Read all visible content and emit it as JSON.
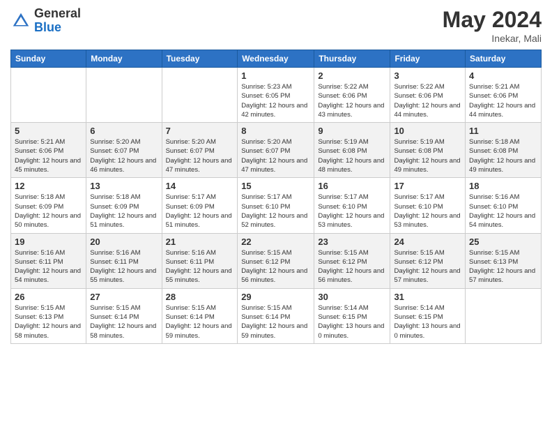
{
  "logo": {
    "general": "General",
    "blue": "Blue"
  },
  "title": "May 2024",
  "location": "Inekar, Mali",
  "headers": [
    "Sunday",
    "Monday",
    "Tuesday",
    "Wednesday",
    "Thursday",
    "Friday",
    "Saturday"
  ],
  "weeks": [
    [
      {
        "day": "",
        "sunrise": "",
        "sunset": "",
        "daylight": ""
      },
      {
        "day": "",
        "sunrise": "",
        "sunset": "",
        "daylight": ""
      },
      {
        "day": "",
        "sunrise": "",
        "sunset": "",
        "daylight": ""
      },
      {
        "day": "1",
        "sunrise": "Sunrise: 5:23 AM",
        "sunset": "Sunset: 6:05 PM",
        "daylight": "Daylight: 12 hours and 42 minutes."
      },
      {
        "day": "2",
        "sunrise": "Sunrise: 5:22 AM",
        "sunset": "Sunset: 6:06 PM",
        "daylight": "Daylight: 12 hours and 43 minutes."
      },
      {
        "day": "3",
        "sunrise": "Sunrise: 5:22 AM",
        "sunset": "Sunset: 6:06 PM",
        "daylight": "Daylight: 12 hours and 44 minutes."
      },
      {
        "day": "4",
        "sunrise": "Sunrise: 5:21 AM",
        "sunset": "Sunset: 6:06 PM",
        "daylight": "Daylight: 12 hours and 44 minutes."
      }
    ],
    [
      {
        "day": "5",
        "sunrise": "Sunrise: 5:21 AM",
        "sunset": "Sunset: 6:06 PM",
        "daylight": "Daylight: 12 hours and 45 minutes."
      },
      {
        "day": "6",
        "sunrise": "Sunrise: 5:20 AM",
        "sunset": "Sunset: 6:07 PM",
        "daylight": "Daylight: 12 hours and 46 minutes."
      },
      {
        "day": "7",
        "sunrise": "Sunrise: 5:20 AM",
        "sunset": "Sunset: 6:07 PM",
        "daylight": "Daylight: 12 hours and 47 minutes."
      },
      {
        "day": "8",
        "sunrise": "Sunrise: 5:20 AM",
        "sunset": "Sunset: 6:07 PM",
        "daylight": "Daylight: 12 hours and 47 minutes."
      },
      {
        "day": "9",
        "sunrise": "Sunrise: 5:19 AM",
        "sunset": "Sunset: 6:08 PM",
        "daylight": "Daylight: 12 hours and 48 minutes."
      },
      {
        "day": "10",
        "sunrise": "Sunrise: 5:19 AM",
        "sunset": "Sunset: 6:08 PM",
        "daylight": "Daylight: 12 hours and 49 minutes."
      },
      {
        "day": "11",
        "sunrise": "Sunrise: 5:18 AM",
        "sunset": "Sunset: 6:08 PM",
        "daylight": "Daylight: 12 hours and 49 minutes."
      }
    ],
    [
      {
        "day": "12",
        "sunrise": "Sunrise: 5:18 AM",
        "sunset": "Sunset: 6:09 PM",
        "daylight": "Daylight: 12 hours and 50 minutes."
      },
      {
        "day": "13",
        "sunrise": "Sunrise: 5:18 AM",
        "sunset": "Sunset: 6:09 PM",
        "daylight": "Daylight: 12 hours and 51 minutes."
      },
      {
        "day": "14",
        "sunrise": "Sunrise: 5:17 AM",
        "sunset": "Sunset: 6:09 PM",
        "daylight": "Daylight: 12 hours and 51 minutes."
      },
      {
        "day": "15",
        "sunrise": "Sunrise: 5:17 AM",
        "sunset": "Sunset: 6:10 PM",
        "daylight": "Daylight: 12 hours and 52 minutes."
      },
      {
        "day": "16",
        "sunrise": "Sunrise: 5:17 AM",
        "sunset": "Sunset: 6:10 PM",
        "daylight": "Daylight: 12 hours and 53 minutes."
      },
      {
        "day": "17",
        "sunrise": "Sunrise: 5:17 AM",
        "sunset": "Sunset: 6:10 PM",
        "daylight": "Daylight: 12 hours and 53 minutes."
      },
      {
        "day": "18",
        "sunrise": "Sunrise: 5:16 AM",
        "sunset": "Sunset: 6:10 PM",
        "daylight": "Daylight: 12 hours and 54 minutes."
      }
    ],
    [
      {
        "day": "19",
        "sunrise": "Sunrise: 5:16 AM",
        "sunset": "Sunset: 6:11 PM",
        "daylight": "Daylight: 12 hours and 54 minutes."
      },
      {
        "day": "20",
        "sunrise": "Sunrise: 5:16 AM",
        "sunset": "Sunset: 6:11 PM",
        "daylight": "Daylight: 12 hours and 55 minutes."
      },
      {
        "day": "21",
        "sunrise": "Sunrise: 5:16 AM",
        "sunset": "Sunset: 6:11 PM",
        "daylight": "Daylight: 12 hours and 55 minutes."
      },
      {
        "day": "22",
        "sunrise": "Sunrise: 5:15 AM",
        "sunset": "Sunset: 6:12 PM",
        "daylight": "Daylight: 12 hours and 56 minutes."
      },
      {
        "day": "23",
        "sunrise": "Sunrise: 5:15 AM",
        "sunset": "Sunset: 6:12 PM",
        "daylight": "Daylight: 12 hours and 56 minutes."
      },
      {
        "day": "24",
        "sunrise": "Sunrise: 5:15 AM",
        "sunset": "Sunset: 6:12 PM",
        "daylight": "Daylight: 12 hours and 57 minutes."
      },
      {
        "day": "25",
        "sunrise": "Sunrise: 5:15 AM",
        "sunset": "Sunset: 6:13 PM",
        "daylight": "Daylight: 12 hours and 57 minutes."
      }
    ],
    [
      {
        "day": "26",
        "sunrise": "Sunrise: 5:15 AM",
        "sunset": "Sunset: 6:13 PM",
        "daylight": "Daylight: 12 hours and 58 minutes."
      },
      {
        "day": "27",
        "sunrise": "Sunrise: 5:15 AM",
        "sunset": "Sunset: 6:14 PM",
        "daylight": "Daylight: 12 hours and 58 minutes."
      },
      {
        "day": "28",
        "sunrise": "Sunrise: 5:15 AM",
        "sunset": "Sunset: 6:14 PM",
        "daylight": "Daylight: 12 hours and 59 minutes."
      },
      {
        "day": "29",
        "sunrise": "Sunrise: 5:15 AM",
        "sunset": "Sunset: 6:14 PM",
        "daylight": "Daylight: 12 hours and 59 minutes."
      },
      {
        "day": "30",
        "sunrise": "Sunrise: 5:14 AM",
        "sunset": "Sunset: 6:15 PM",
        "daylight": "Daylight: 13 hours and 0 minutes."
      },
      {
        "day": "31",
        "sunrise": "Sunrise: 5:14 AM",
        "sunset": "Sunset: 6:15 PM",
        "daylight": "Daylight: 13 hours and 0 minutes."
      },
      {
        "day": "",
        "sunrise": "",
        "sunset": "",
        "daylight": ""
      }
    ]
  ]
}
